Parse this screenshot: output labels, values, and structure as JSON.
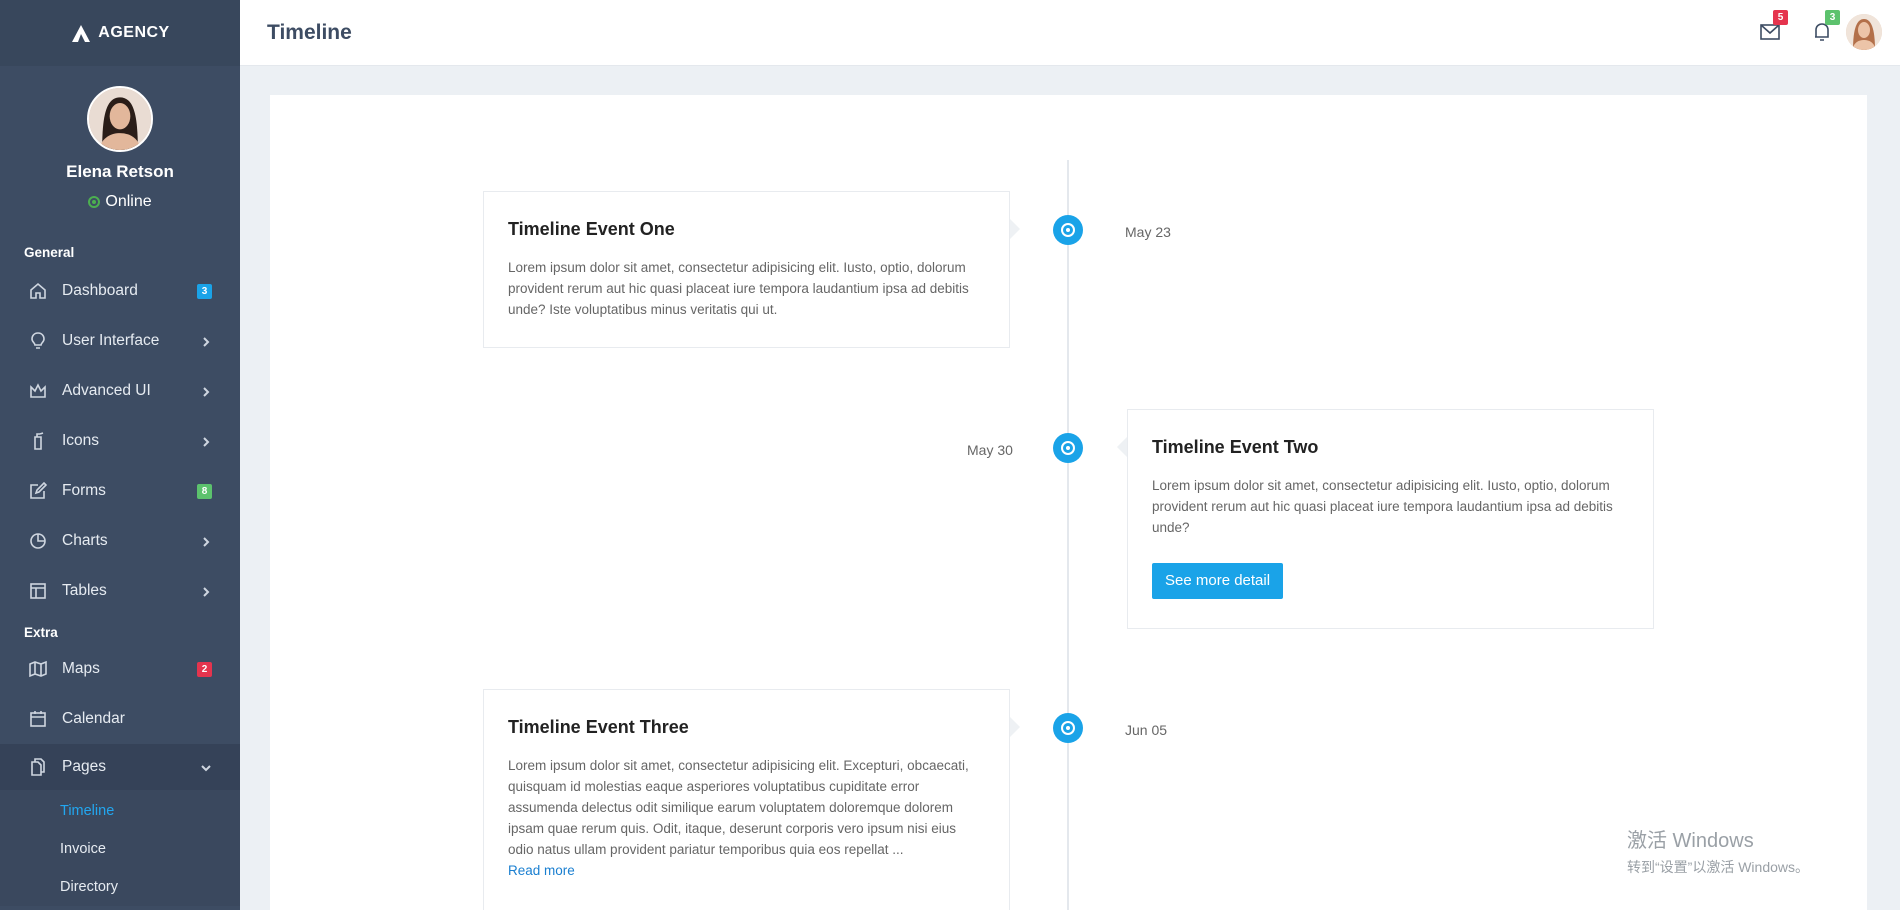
{
  "brand": {
    "name": "AGENCY"
  },
  "profile": {
    "name": "Elena Retson",
    "status": "Online"
  },
  "sidebar": {
    "general_title": "General",
    "extra_title": "Extra",
    "items": [
      {
        "label": "Dashboard",
        "icon": "home-icon",
        "badge": "3",
        "badge_color": "#1aa3e8"
      },
      {
        "label": "User Interface",
        "icon": "lightbulb-icon"
      },
      {
        "label": "Advanced UI",
        "icon": "crown-icon"
      },
      {
        "label": "Icons",
        "icon": "fire-extinguisher-icon"
      },
      {
        "label": "Forms",
        "icon": "edit-icon",
        "badge": "8",
        "badge_color": "#5cc26d"
      },
      {
        "label": "Charts",
        "icon": "pie-chart-icon"
      },
      {
        "label": "Tables",
        "icon": "table-icon"
      },
      {
        "label": "Maps",
        "icon": "map-icon",
        "badge": "2",
        "badge_color": "#e5344e"
      },
      {
        "label": "Calendar",
        "icon": "calendar-icon"
      },
      {
        "label": "Pages",
        "icon": "pages-icon"
      }
    ],
    "sub_items": [
      "Timeline",
      "Invoice",
      "Directory"
    ]
  },
  "header": {
    "title": "Timeline",
    "mail_badge": "5",
    "bell_badge": "3"
  },
  "timeline": [
    {
      "title": "Timeline Event One",
      "date": "May 23",
      "text": "Lorem ipsum dolor sit amet, consectetur adipisicing elit. Iusto, optio, dolorum provident rerum aut hic quasi placeat iure tempora laudantium ipsa ad debitis unde? Iste voluptatibus minus veritatis qui ut."
    },
    {
      "title": "Timeline Event Two",
      "date": "May 30",
      "text": "Lorem ipsum dolor sit amet, consectetur adipisicing elit. Iusto, optio, dolorum provident rerum aut hic quasi placeat iure tempora laudantium ipsa ad debitis unde?",
      "button": "See more detail"
    },
    {
      "title": "Timeline Event Three",
      "date": "Jun 05",
      "text": "Lorem ipsum dolor sit amet, consectetur adipisicing elit. Excepturi, obcaecati, quisquam id molestias eaque asperiores voluptatibus cupiditate error assumenda delectus odit similique earum voluptatem doloremque dolorem ipsam quae rerum quis. Odit, itaque, deserunt corporis vero ipsum nisi eius odio natus ullam provident pariatur temporibus quia eos repellat ...",
      "link": "Read more"
    }
  ],
  "watermark": {
    "line1": "激活 Windows",
    "line2": "转到“设置”以激活 Windows。"
  },
  "colors": {
    "accent": "#1aa3e8",
    "sidebar": "#3d4c63"
  }
}
